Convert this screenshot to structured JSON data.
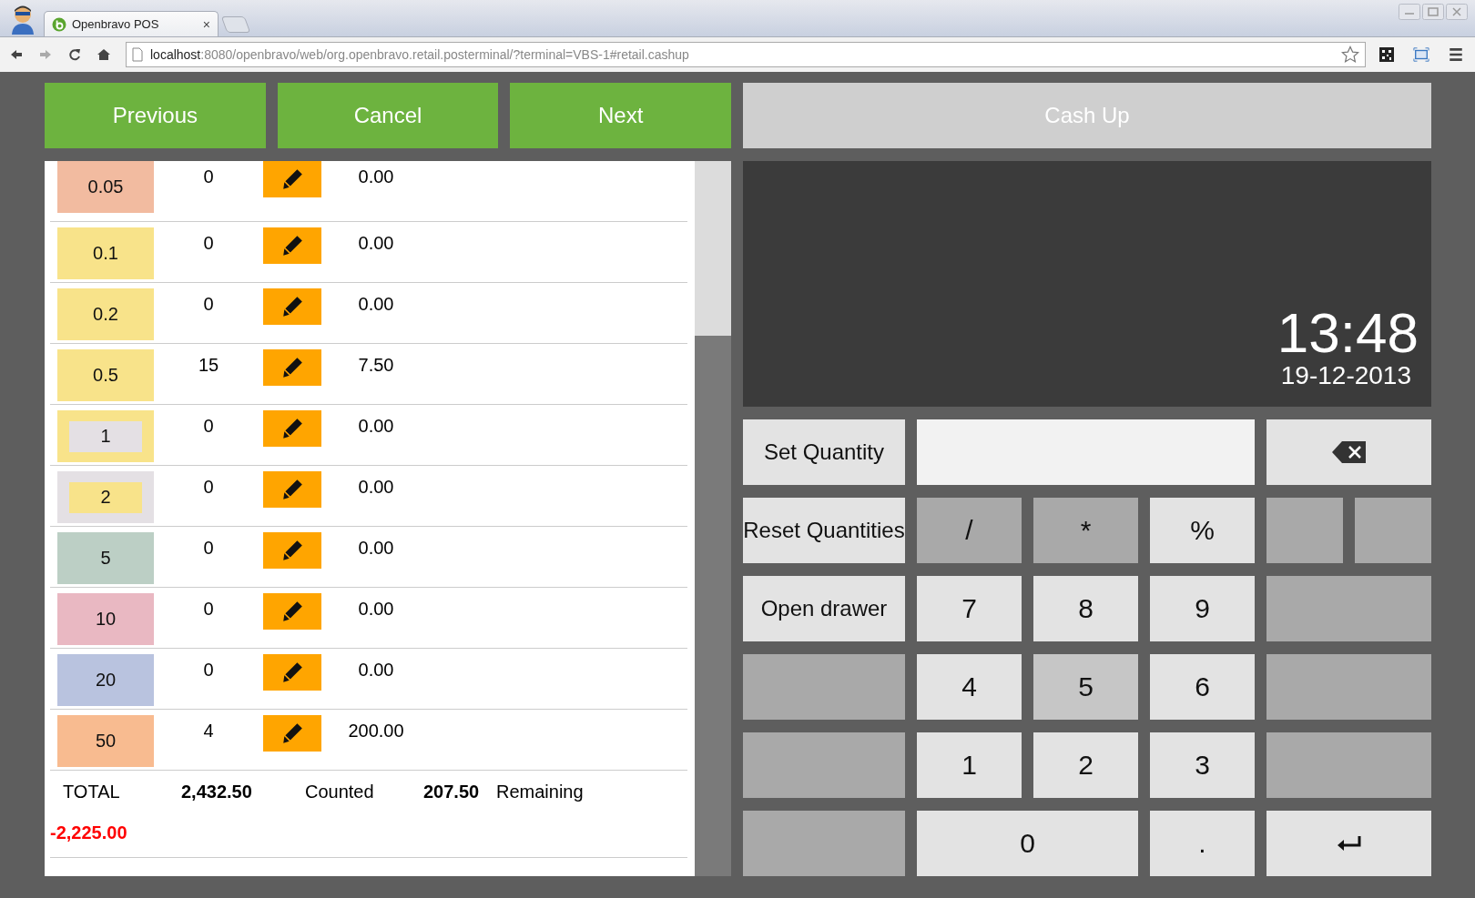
{
  "browser": {
    "tab_title": "Openbravo POS",
    "tab_close": "×",
    "url_host": "localhost",
    "url_rest": ":8080/openbravo/web/org.openbravo.retail.posterminal/?terminal=VBS-1#retail.cashup"
  },
  "nav_buttons": [
    {
      "label": "Previous",
      "disabled": false
    },
    {
      "label": "Cancel",
      "disabled": false
    },
    {
      "label": "Next",
      "disabled": false
    },
    {
      "label": "Cash Up",
      "disabled": true
    }
  ],
  "denominations": [
    {
      "value": "0.05",
      "color": "#f2bba0",
      "quantity": "0",
      "amount": "0.00"
    },
    {
      "value": "0.1",
      "color": "#f8e38a",
      "quantity": "0",
      "amount": "0.00"
    },
    {
      "value": "0.2",
      "color": "#f8e38a",
      "quantity": "0",
      "amount": "0.00"
    },
    {
      "value": "0.5",
      "color": "#f8e38a",
      "quantity": "15",
      "amount": "7.50"
    },
    {
      "value": "1",
      "color": "#f8e38a",
      "inner": {
        "color": "#e4e0e4"
      },
      "quantity": "0",
      "amount": "0.00"
    },
    {
      "value": "2",
      "color": "#e4e0e4",
      "inner": {
        "color": "#f8e38a"
      },
      "quantity": "0",
      "amount": "0.00"
    },
    {
      "value": "5",
      "color": "#bccfc5",
      "quantity": "0",
      "amount": "0.00"
    },
    {
      "value": "10",
      "color": "#e9b8c2",
      "quantity": "0",
      "amount": "0.00"
    },
    {
      "value": "20",
      "color": "#b9c3df",
      "quantity": "0",
      "amount": "0.00"
    },
    {
      "value": "50",
      "color": "#f8bb90",
      "quantity": "4",
      "amount": "200.00"
    }
  ],
  "totals": {
    "total_label": "TOTAL",
    "total": "2,432.50",
    "counted_label": "Counted",
    "counted": "207.50",
    "remaining_label": "Remaining",
    "remaining": "-2,225.00"
  },
  "display": {
    "time": "13:48",
    "date": "19-12-2013"
  },
  "keypad": [
    [
      {
        "kind": "action",
        "label": "Set Quantity"
      },
      {
        "kind": "field"
      },
      {
        "kind": "backspace"
      }
    ],
    [
      {
        "kind": "action",
        "label": "Reset Quantities"
      },
      {
        "kind": "operator",
        "label": "/"
      },
      {
        "kind": "operator",
        "label": "*"
      },
      {
        "kind": "digit",
        "label": "%"
      },
      {
        "kind": "split-blank"
      }
    ],
    [
      {
        "kind": "action",
        "label": "Open drawer"
      },
      {
        "kind": "digit",
        "label": "7"
      },
      {
        "kind": "digit",
        "label": "8"
      },
      {
        "kind": "digit",
        "label": "9"
      },
      {
        "kind": "blank"
      }
    ],
    [
      {
        "kind": "blank"
      },
      {
        "kind": "digit",
        "label": "4"
      },
      {
        "kind": "hover-digit",
        "label": "5"
      },
      {
        "kind": "digit",
        "label": "6"
      },
      {
        "kind": "blank"
      }
    ],
    [
      {
        "kind": "blank"
      },
      {
        "kind": "digit",
        "label": "1"
      },
      {
        "kind": "digit",
        "label": "2"
      },
      {
        "kind": "digit",
        "label": "3"
      },
      {
        "kind": "blank"
      }
    ],
    [
      {
        "kind": "blank"
      },
      {
        "kind": "wide-digit",
        "label": "0"
      },
      {
        "kind": "digit",
        "label": "."
      },
      {
        "kind": "enter"
      }
    ]
  ]
}
